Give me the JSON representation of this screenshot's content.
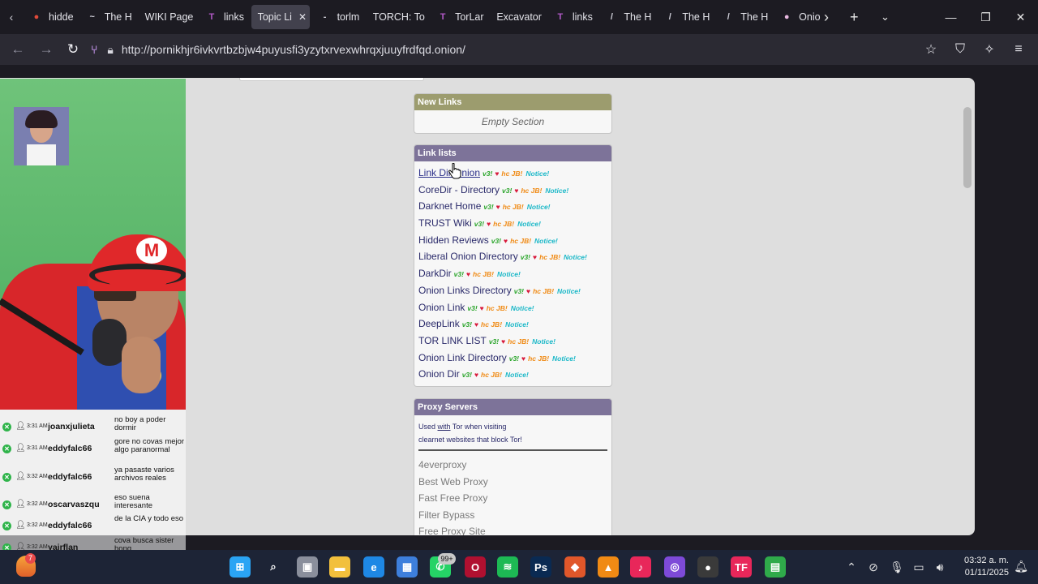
{
  "tabs": [
    {
      "label": "hidde",
      "fav_color": "#e04a3a",
      "fav": "●"
    },
    {
      "label": "The H",
      "fav_color": "#cfcfd8",
      "fav": "~"
    },
    {
      "label": "WIKI Page",
      "fav_color": "",
      "fav": ""
    },
    {
      "label": "links",
      "fav_color": "#b35ac8",
      "fav": "T"
    },
    {
      "label": "Topic Li",
      "fav_color": "",
      "fav": "",
      "active": true
    },
    {
      "label": "torlm",
      "fav_color": "#cfcfd8",
      "fav": "-"
    },
    {
      "label": "TORCH: To",
      "fav_color": "",
      "fav": ""
    },
    {
      "label": "TorLar",
      "fav_color": "#b35ac8",
      "fav": "T"
    },
    {
      "label": "Excavator",
      "fav_color": "",
      "fav": ""
    },
    {
      "label": "links",
      "fav_color": "#b35ac8",
      "fav": "T"
    },
    {
      "label": "The H",
      "fav_color": "#cfcfd8",
      "fav": "/"
    },
    {
      "label": "The H",
      "fav_color": "#cfcfd8",
      "fav": "/"
    },
    {
      "label": "The H",
      "fav_color": "#cfcfd8",
      "fav": "/"
    },
    {
      "label": "Onio",
      "fav_color": "#e8b8e0",
      "fav": "●"
    }
  ],
  "browser": {
    "url": "http://pornikhjr6ivkvrtbzbjw4puyusfi3yzytxrvexwhrqxjuuyfrdfqd.onion/",
    "tab_close_glyph": "✕"
  },
  "sections": {
    "new_links": {
      "title": "New Links",
      "empty_text": "Empty Section"
    },
    "link_lists": {
      "title": "Link lists",
      "items": [
        "Link Dir Onion",
        "CoreDir - Directory",
        "Darknet Home",
        "TRUST Wiki",
        "Hidden Reviews",
        "Liberal Onion Directory",
        "DarkDir",
        "Onion Links Directory",
        "Onion Link",
        "DeepLink",
        "TOR LINK LIST",
        "Onion Link Directory",
        "Onion Dir"
      ],
      "tag_v3": "v3!",
      "tag_heart": "♥",
      "tag_jb": "hc JB!",
      "tag_notice": "Notice!"
    },
    "proxy_servers": {
      "title": "Proxy Servers",
      "info_line1_a": "Used ",
      "info_line1_b": "with",
      "info_line1_c": " Tor when visiting",
      "info_line2": "clearnet websites that block Tor!",
      "items": [
        "4everproxy",
        "Best Web Proxy",
        "Fast Free Proxy",
        "Filter Bypass",
        "Free Proxy Site"
      ]
    }
  },
  "chat": [
    {
      "time": "3:31 AM",
      "user": "joanxjulieta",
      "msg": "no boy a poder dormir"
    },
    {
      "time": "3:31 AM",
      "user": "eddyfalc66",
      "msg": "gore no covas mejor algo paranormal"
    },
    {
      "time": "3:32 AM",
      "user": "eddyfalc66",
      "msg": "ya pasaste varios archivos reales"
    },
    {
      "time": "3:32 AM",
      "user": "oscarvaszqu",
      "msg": "eso suena interesante"
    },
    {
      "time": "3:32 AM",
      "user": "eddyfalc66",
      "msg": "de la CIA y todo eso"
    },
    {
      "time": "3:32 AM",
      "user": "yairflan",
      "msg": "cova busca sister hong"
    }
  ],
  "taskbar": {
    "badge_count": "7",
    "whatsapp_badge": "99+",
    "time": "03:32 a. m.",
    "date": "01/11/2025",
    "apps": [
      {
        "name": "windows-start-icon",
        "color": "#2aa4f4",
        "glyph": "⊞"
      },
      {
        "name": "search-icon",
        "color": "",
        "glyph": "⌕"
      },
      {
        "name": "task-view-icon",
        "color": "#8a8f9c",
        "glyph": "▣"
      },
      {
        "name": "file-explorer-icon",
        "color": "#f2c03c",
        "glyph": "▬"
      },
      {
        "name": "edge-icon",
        "color": "#1e88e5",
        "glyph": "e"
      },
      {
        "name": "store-icon",
        "color": "#3d7fdc",
        "glyph": "▦"
      },
      {
        "name": "whatsapp-icon",
        "color": "#25d366",
        "glyph": "✆"
      },
      {
        "name": "opera-icon",
        "color": "#b01030",
        "glyph": "O"
      },
      {
        "name": "spotify-icon",
        "color": "#1db954",
        "glyph": "≋"
      },
      {
        "name": "photoshop-icon",
        "color": "#0a2a52",
        "glyph": "Ps"
      },
      {
        "name": "brave-icon",
        "color": "#e0572a",
        "glyph": "◆"
      },
      {
        "name": "vlc-icon",
        "color": "#f08a14",
        "glyph": "▲"
      },
      {
        "name": "tiktok-icon",
        "color": "#e8275a",
        "glyph": "♪"
      },
      {
        "name": "tor-browser-icon",
        "color": "#7d4ad8",
        "glyph": "◎"
      },
      {
        "name": "obs-icon",
        "color": "#3a3a3a",
        "glyph": "●"
      },
      {
        "name": "tf-app-icon",
        "color": "#e8275a",
        "glyph": "TF"
      },
      {
        "name": "app-icon",
        "color": "#2faa4a",
        "glyph": "▤"
      }
    ]
  }
}
